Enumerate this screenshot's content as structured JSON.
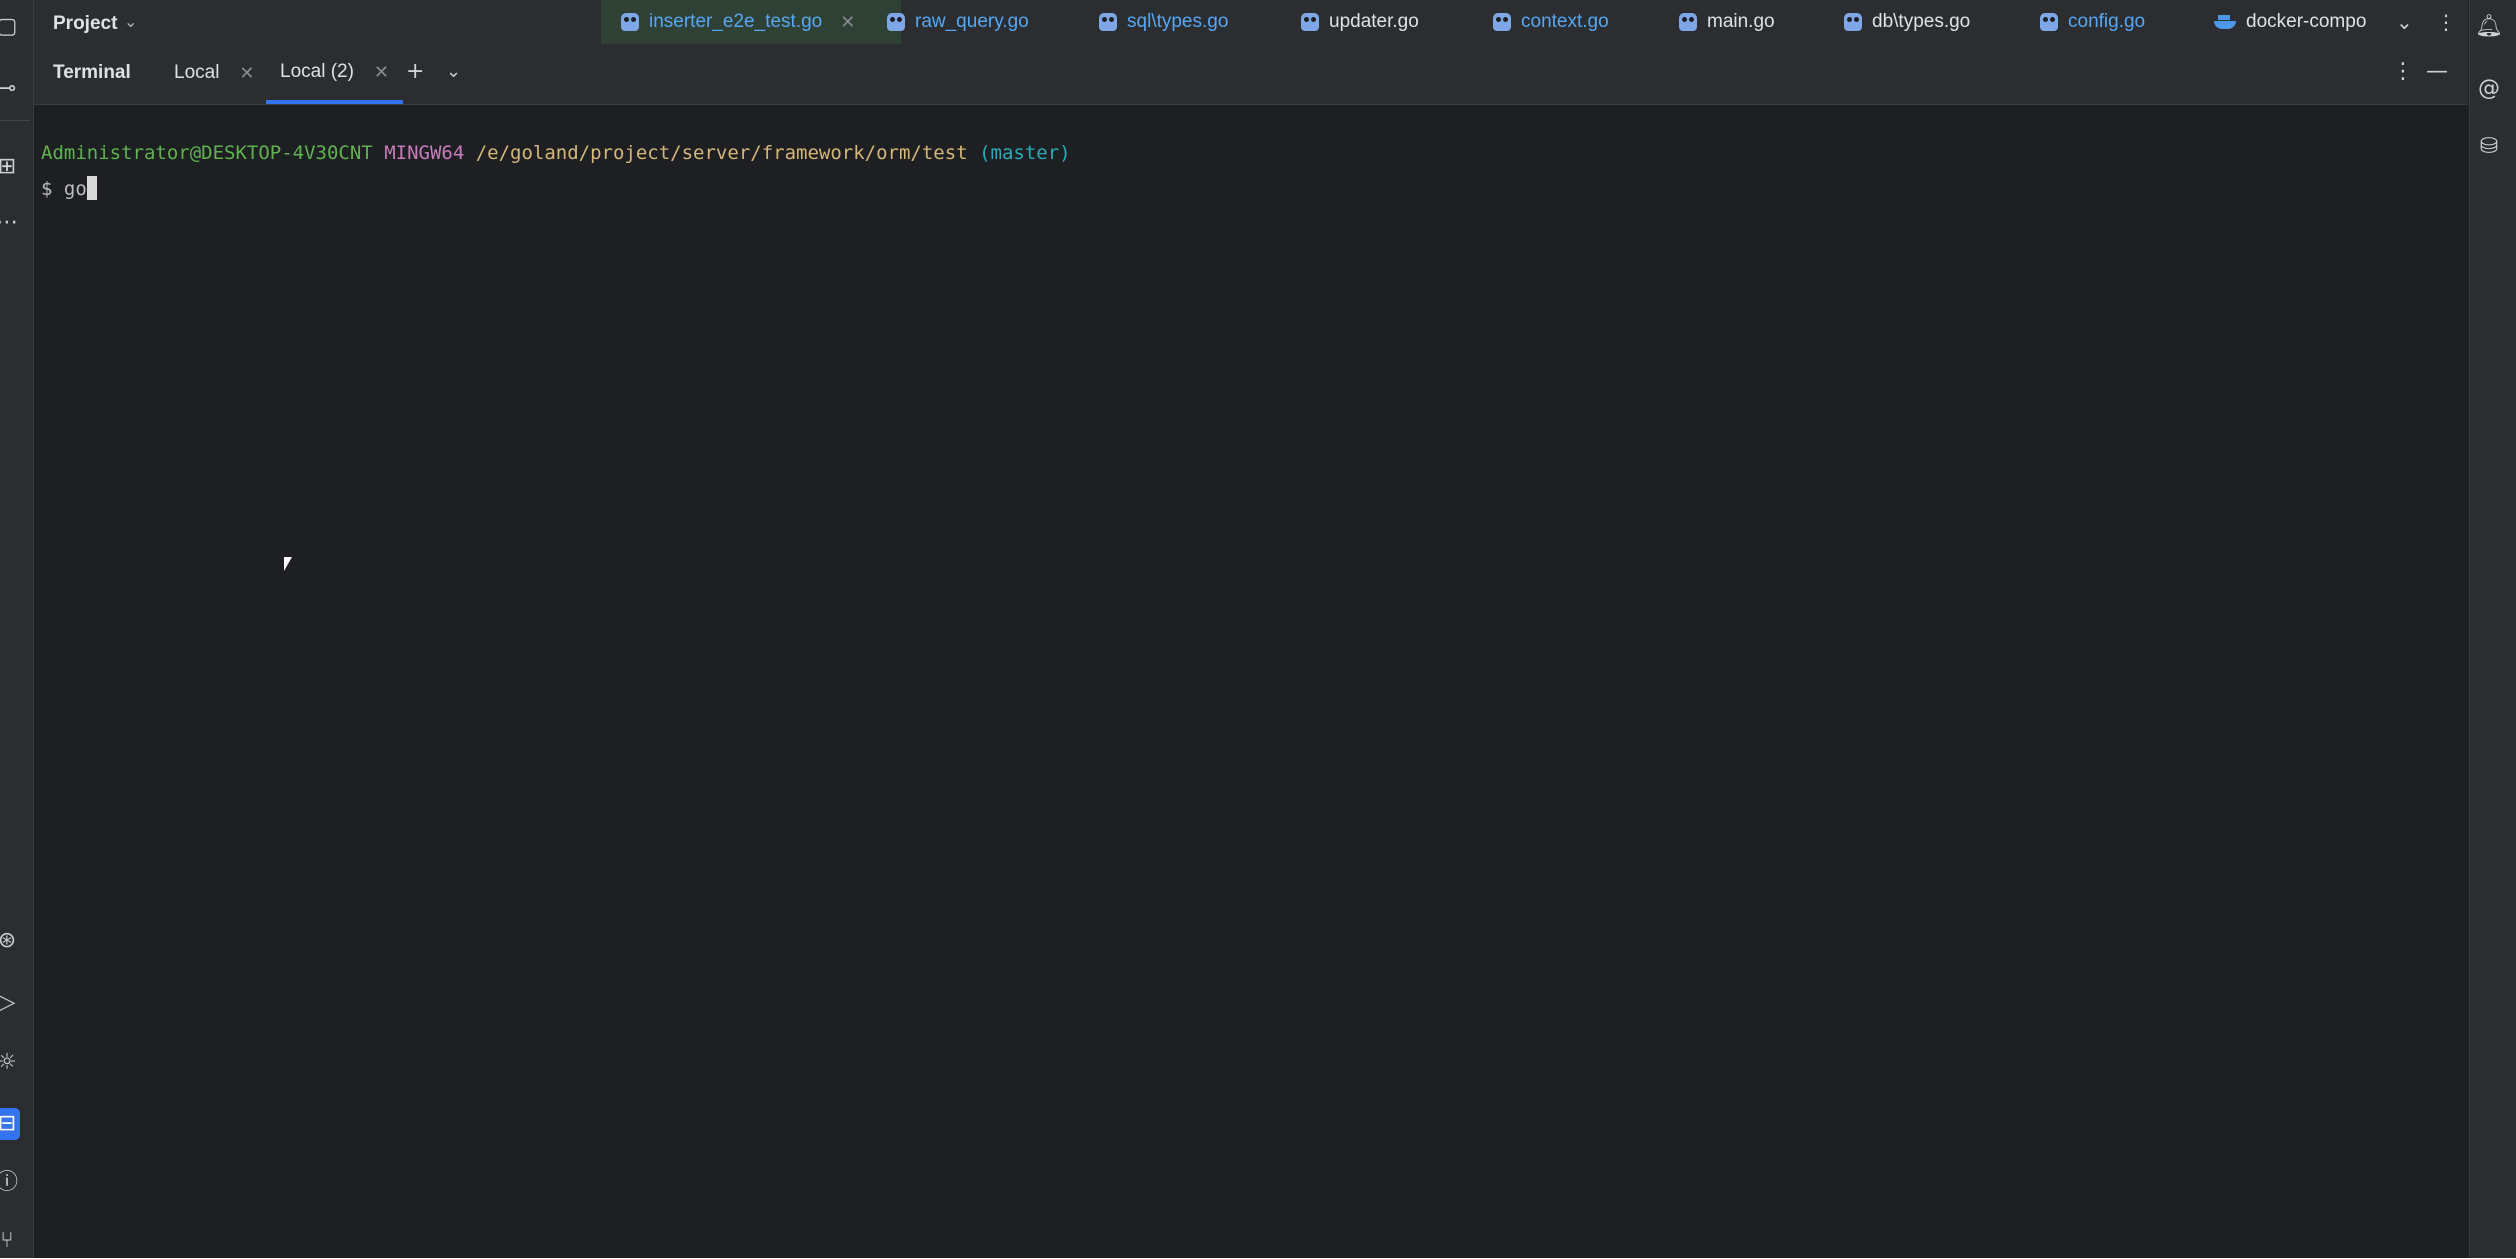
{
  "top_bar": {
    "project_label": "Project",
    "editor_tabs": [
      {
        "label": "inserter_e2e_test.go",
        "color": "#56a8f5",
        "active": true,
        "closable": true
      },
      {
        "label": "raw_query.go",
        "color": "#56a8f5"
      },
      {
        "label": "sql\\types.go",
        "color": "#56a8f5"
      },
      {
        "label": "updater.go",
        "color": "#dfe1e5"
      },
      {
        "label": "context.go",
        "color": "#56a8f5"
      },
      {
        "label": "main.go",
        "color": "#dfe1e5"
      },
      {
        "label": "db\\types.go",
        "color": "#dfe1e5"
      },
      {
        "label": "config.go",
        "color": "#56a8f5"
      },
      {
        "label": "docker-compo",
        "color": "#dfe1e5",
        "icon": "docker-icon"
      }
    ]
  },
  "terminal": {
    "title": "Terminal",
    "tabs": [
      {
        "label": "Local"
      },
      {
        "label": "Local (2)",
        "active": true
      }
    ],
    "prompt_line": {
      "user_host": "Administrator@DESKTOP-4V30CNT",
      "system": "MINGW64",
      "path": "/e/goland/project/server/framework/orm/test",
      "branch": "(master)"
    },
    "input_line": {
      "prompt": "$ ",
      "command": "go"
    }
  },
  "colors": {
    "accent": "#3574f0",
    "background": "#1e1f22",
    "panel": "#2b2d30",
    "user_host": "#5fb34f",
    "system": "#c77dbb",
    "path": "#d5b778",
    "branch": "#2aacb8"
  }
}
